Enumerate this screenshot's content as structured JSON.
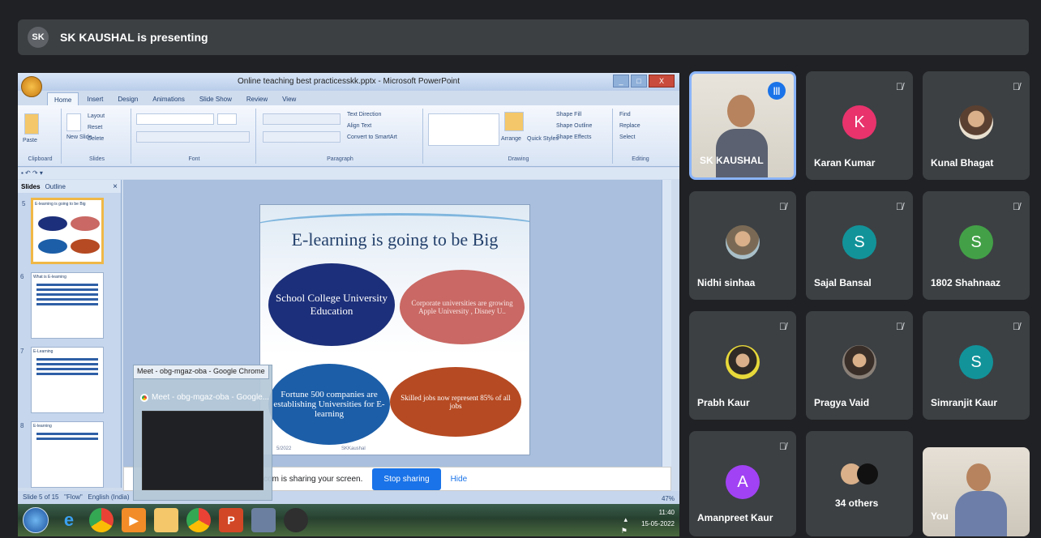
{
  "meet": {
    "presenter_initials": "SK",
    "presenter_text": "SK KAUSHAL is presenting"
  },
  "powerpoint": {
    "window_title": "Online teaching best practicesskk.pptx - Microsoft PowerPoint",
    "tabs": [
      "Home",
      "Insert",
      "Design",
      "Animations",
      "Slide Show",
      "Review",
      "View"
    ],
    "groups": {
      "clipboard": "Clipboard",
      "slides": "Slides",
      "font": "Font",
      "paragraph": "Paragraph",
      "drawing": "Drawing",
      "editing": "Editing"
    },
    "ribbon_items": {
      "paste": "Paste",
      "new_slide": "New Slide",
      "layout": "Layout",
      "reset": "Reset",
      "delete": "Delete",
      "text_direction": "Text Direction",
      "align_text": "Align Text",
      "convert_smartart": "Convert to SmartArt",
      "arrange": "Arrange",
      "quick_styles": "Quick Styles",
      "shape_fill": "Shape Fill",
      "shape_outline": "Shape Outline",
      "shape_effects": "Shape Effects",
      "find": "Find",
      "replace": "Replace",
      "select": "Select"
    },
    "pane_tabs": {
      "slides": "Slides",
      "outline": "Outline"
    },
    "thumb_nums": [
      "5",
      "6",
      "7",
      "8"
    ],
    "thumb_titles": [
      "E-learning is going to be Big",
      "What is E-learning",
      "E-Learning",
      "E-learning"
    ],
    "slide": {
      "title": "E-learning is going to be Big",
      "bubble1": "School College University Education",
      "bubble2": "Corporate universities are growing Apple University , Disney U..",
      "bubble3": "Fortune 500 companies are establishing Universities for E-learning",
      "bubble4": "Skilled jobs now represent 85% of all jobs",
      "footer_left": "5/2022",
      "footer_right": "SKKaushal"
    },
    "status": {
      "slide_info": "Slide 5 of 15",
      "theme": "\"Flow\"",
      "language": "English (India)",
      "zoom": "47%"
    }
  },
  "share_bar": {
    "message": "ple.com is sharing your screen.",
    "stop": "Stop sharing",
    "hide": "Hide"
  },
  "chrome_preview": {
    "tooltip": "Meet - obg-mgaz-oba - Google Chrome",
    "title": "Meet - obg-mgaz-oba - Google..."
  },
  "taskbar": {
    "time": "11:40",
    "date": "15-05-2022"
  },
  "participants": [
    {
      "name": "SK KAUSHAL",
      "type": "video",
      "speaking": true
    },
    {
      "name": "Karan Kumar",
      "type": "initial",
      "initial": "K",
      "color": "#e8336d"
    },
    {
      "name": "Kunal Bhagat",
      "type": "photo"
    },
    {
      "name": "Nidhi sinhaa",
      "type": "photo"
    },
    {
      "name": "Sajal Bansal",
      "type": "initial",
      "initial": "S",
      "color": "#12939a"
    },
    {
      "name": "1802 Shahnaaz",
      "type": "initial",
      "initial": "S",
      "color": "#43a047"
    },
    {
      "name": "Prabh Kaur",
      "type": "photo"
    },
    {
      "name": "Pragya Vaid",
      "type": "photo"
    },
    {
      "name": "Simranjit Kaur",
      "type": "initial",
      "initial": "S",
      "color": "#12939a"
    },
    {
      "name": "Amanpreet Kaur",
      "type": "initial",
      "initial": "A",
      "color": "#a142f4"
    },
    {
      "name": "34 others",
      "type": "others"
    },
    {
      "name": "You",
      "type": "video"
    }
  ],
  "colors": {
    "meet_bg": "#202124",
    "tile_bg": "#3c4043",
    "accent": "#1a73e8"
  }
}
